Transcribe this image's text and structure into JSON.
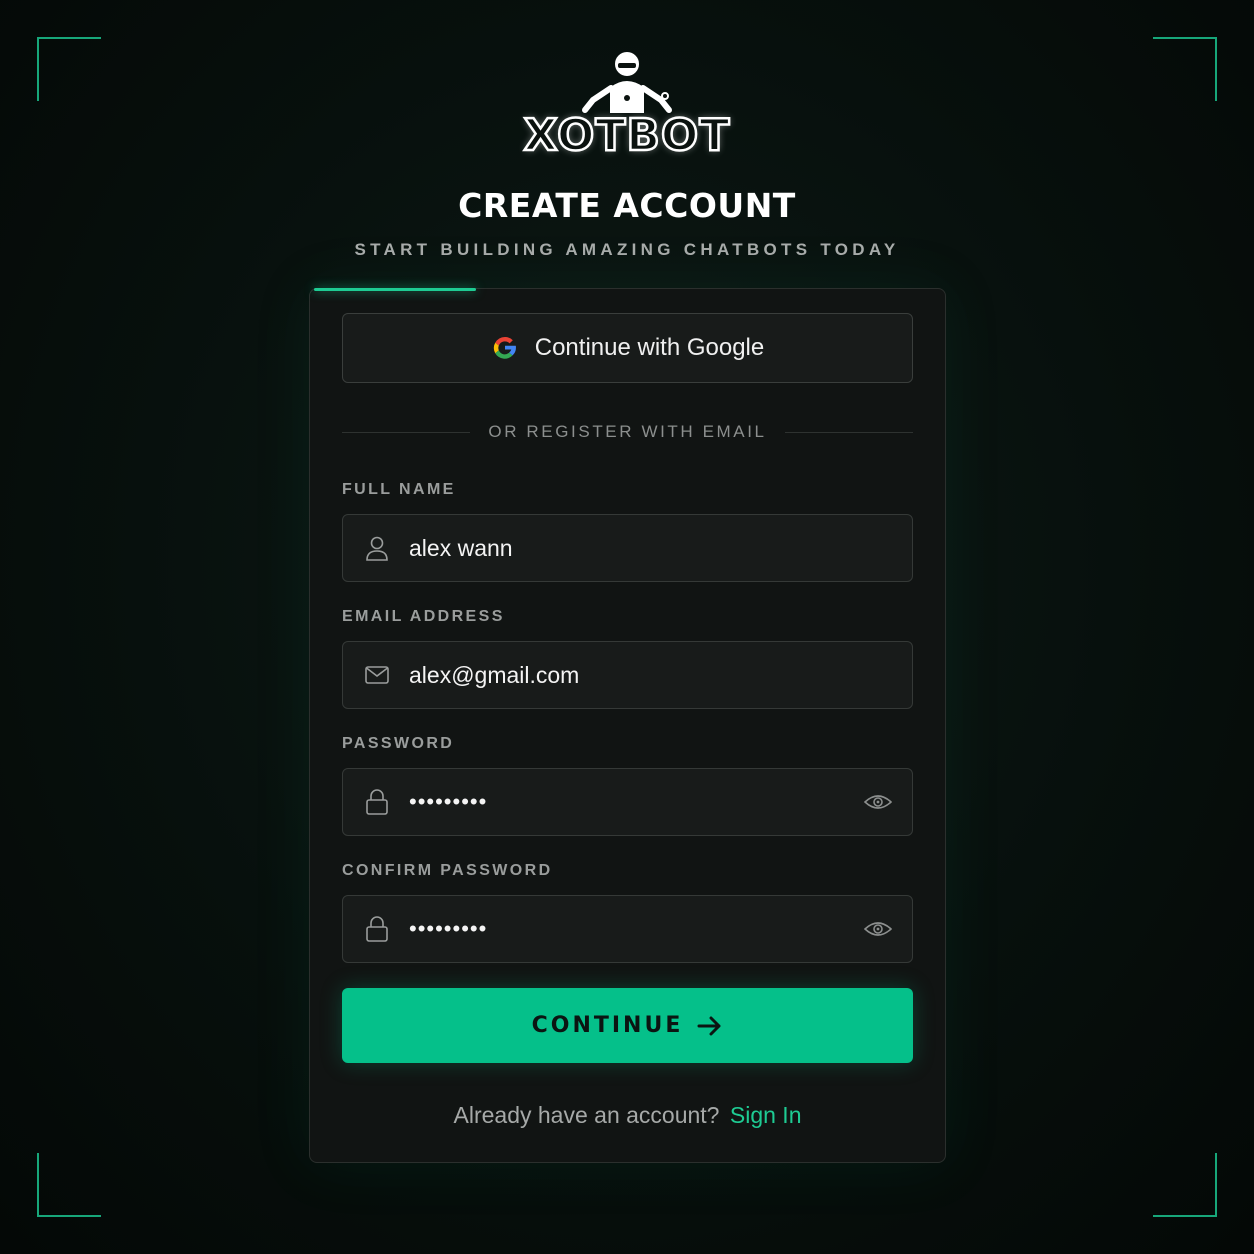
{
  "brand": {
    "name": "XOTBOT"
  },
  "header": {
    "title": "CREATE ACCOUNT",
    "subtitle": "START BUILDING AMAZING CHATBOTS TODAY"
  },
  "form": {
    "google_label": "Continue with Google",
    "divider_text": "OR REGISTER WITH EMAIL",
    "full_name": {
      "label": "FULL NAME",
      "value": "alex wann"
    },
    "email": {
      "label": "EMAIL ADDRESS",
      "value": "alex@gmail.com"
    },
    "password": {
      "label": "PASSWORD",
      "value": "•••••••••"
    },
    "confirm_password": {
      "label": "CONFIRM PASSWORD",
      "value": "•••••••••"
    },
    "continue_label": "CONTINUE",
    "footer_text": "Already have an account?",
    "signin_label": "Sign In"
  },
  "icons": {
    "logo": "robot-mascot-icon",
    "google": "google-icon",
    "full_name": "user-icon",
    "email": "mail-icon",
    "password": "lock-icon",
    "visibility": "eye-icon",
    "submit": "arrow-right-icon"
  },
  "colors": {
    "accent": "#1ecb93",
    "button": "#05c08a",
    "background": "#07100d",
    "card": "#111413"
  }
}
